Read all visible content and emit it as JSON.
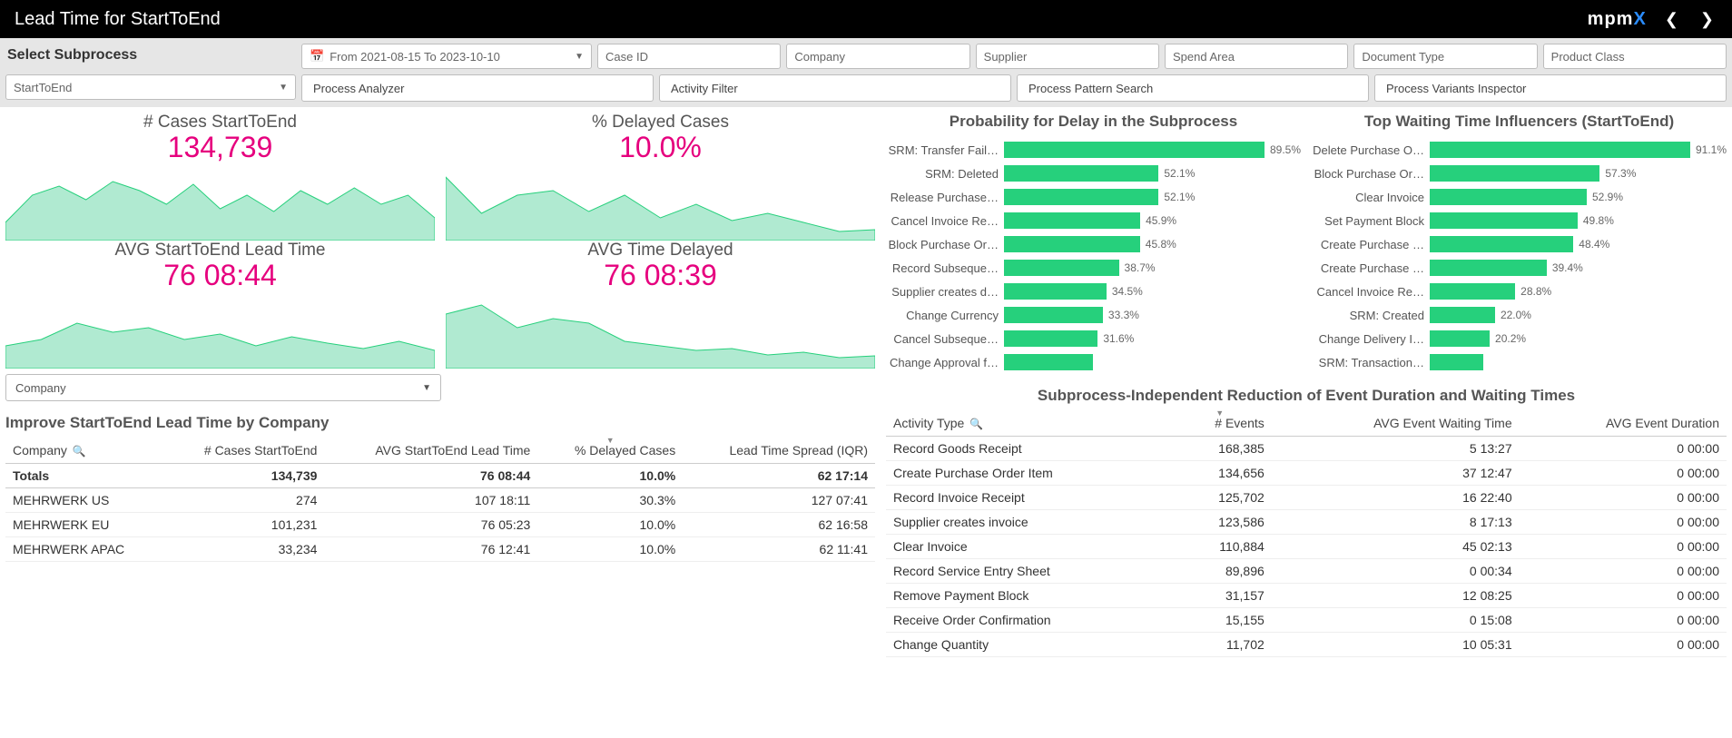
{
  "header": {
    "title": "Lead Time for StartToEnd",
    "logo_main": "mpm",
    "logo_x": "X"
  },
  "filters": {
    "select_label": "Select Subprocess",
    "subprocess_value": "StartToEnd",
    "date_value": "From 2021-08-15 To 2023-10-10",
    "case_id": "Case ID",
    "company": "Company",
    "supplier": "Supplier",
    "spend_area": "Spend Area",
    "document_type": "Document Type",
    "product_class": "Product Class"
  },
  "tabs": {
    "process_analyzer": "Process Analyzer",
    "activity_filter": "Activity Filter",
    "process_pattern_search": "Process Pattern Search",
    "process_variants_inspector": "Process Variants Inspector"
  },
  "kpis": {
    "cases_title": "# Cases StartToEnd",
    "cases_value": "134,739",
    "delayed_pct_title": "% Delayed Cases",
    "delayed_pct_value": "10.0%",
    "avg_lead_title": "AVG StartToEnd Lead Time",
    "avg_lead_value": "76 08:44",
    "avg_delay_title": "AVG Time Delayed",
    "avg_delay_value": "76 08:39"
  },
  "company_dropdown": "Company",
  "improve_table": {
    "title": "Improve StartToEnd Lead Time by Company",
    "cols": {
      "company": "Company",
      "cases": "# Cases StartToEnd",
      "avg_lead": "AVG StartToEnd Lead Time",
      "delayed": "% Delayed Cases",
      "iqr": "Lead Time Spread (IQR)"
    },
    "totals_label": "Totals",
    "totals": {
      "cases": "134,739",
      "avg_lead": "76 08:44",
      "delayed": "10.0%",
      "iqr": "62 17:14"
    },
    "rows": [
      {
        "company": "MEHRWERK US",
        "cases": "274",
        "avg_lead": "107 18:11",
        "delayed": "30.3%",
        "iqr": "127 07:41"
      },
      {
        "company": "MEHRWERK EU",
        "cases": "101,231",
        "avg_lead": "76 05:23",
        "delayed": "10.0%",
        "iqr": "62 16:58"
      },
      {
        "company": "MEHRWERK APAC",
        "cases": "33,234",
        "avg_lead": "76 12:41",
        "delayed": "10.0%",
        "iqr": "62 11:41"
      }
    ]
  },
  "chart_data": [
    {
      "type": "bar",
      "title": "Probability for Delay in the Subprocess",
      "orientation": "horizontal",
      "xlim": [
        0,
        100
      ],
      "categories": [
        "SRM: Transfer Fail…",
        "SRM: Deleted",
        "Release Purchase…",
        "Cancel Invoice Re…",
        "Block Purchase Or…",
        "Record Subseque…",
        "Supplier creates d…",
        "Change Currency",
        "Cancel Subseque…",
        "Change Approval f…"
      ],
      "values": [
        89.5,
        52.1,
        52.1,
        45.9,
        45.8,
        38.7,
        34.5,
        33.3,
        31.6,
        30.0
      ],
      "value_labels": [
        "89.5%",
        "52.1%",
        "52.1%",
        "45.9%",
        "45.8%",
        "38.7%",
        "34.5%",
        "33.3%",
        "31.6%",
        ""
      ]
    },
    {
      "type": "bar",
      "title": "Top Waiting Time Influencers (StartToEnd)",
      "orientation": "horizontal",
      "xlim": [
        0,
        100
      ],
      "categories": [
        "Delete Purchase O…",
        "Block Purchase Or…",
        "Clear Invoice",
        "Set Payment Block",
        "Create Purchase …",
        "Create Purchase …",
        "Cancel Invoice Re…",
        "SRM: Created",
        "Change Delivery I…",
        "SRM: Transaction…"
      ],
      "values": [
        91.1,
        57.3,
        52.9,
        49.8,
        48.4,
        39.4,
        28.8,
        22.0,
        20.2,
        18.0
      ],
      "value_labels": [
        "91.1%",
        "57.3%",
        "52.9%",
        "49.8%",
        "48.4%",
        "39.4%",
        "28.8%",
        "22.0%",
        "20.2%",
        ""
      ]
    }
  ],
  "events_table": {
    "title": "Subprocess-Independent Reduction of Event Duration and Waiting Times",
    "cols": {
      "activity": "Activity Type",
      "events": "# Events",
      "wait": "AVG Event Waiting Time",
      "dur": "AVG Event Duration"
    },
    "rows": [
      {
        "activity": "Record Goods Receipt",
        "events": "168,385",
        "wait": "5 13:27",
        "dur": "0 00:00"
      },
      {
        "activity": "Create Purchase Order Item",
        "events": "134,656",
        "wait": "37 12:47",
        "dur": "0 00:00"
      },
      {
        "activity": "Record Invoice Receipt",
        "events": "125,702",
        "wait": "16 22:40",
        "dur": "0 00:00"
      },
      {
        "activity": "Supplier creates invoice",
        "events": "123,586",
        "wait": "8 17:13",
        "dur": "0 00:00"
      },
      {
        "activity": "Clear Invoice",
        "events": "110,884",
        "wait": "45 02:13",
        "dur": "0 00:00"
      },
      {
        "activity": "Record Service Entry Sheet",
        "events": "89,896",
        "wait": "0 00:34",
        "dur": "0 00:00"
      },
      {
        "activity": "Remove Payment Block",
        "events": "31,157",
        "wait": "12 08:25",
        "dur": "0 00:00"
      },
      {
        "activity": "Receive Order Confirmation",
        "events": "15,155",
        "wait": "0 15:08",
        "dur": "0 00:00"
      },
      {
        "activity": "Change Quantity",
        "events": "11,702",
        "wait": "10 05:31",
        "dur": "0 00:00"
      }
    ]
  }
}
